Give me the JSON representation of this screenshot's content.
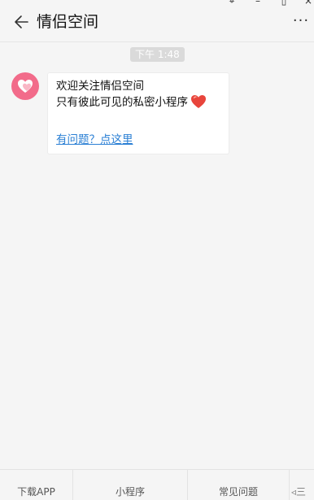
{
  "titlebar": {
    "title": "情侣空间",
    "pin_glyph": "⌖",
    "minimize_glyph": "–",
    "maximize_glyph": "▯",
    "close_glyph": "×",
    "more_glyph": "···"
  },
  "chat": {
    "timestamp": "下午 1:48",
    "message": {
      "line1": "欢迎关注情侣空间",
      "line2": "只有彼此可见的私密小程序",
      "link_text": "有问题？点这里"
    }
  },
  "bottom_menu": {
    "items": [
      "下载APP",
      "小程序",
      "常见问题"
    ],
    "keyboard_label": "◃三"
  },
  "colors": {
    "avatar_bg": "#f26b8a",
    "link": "#2a7fd4",
    "heart_emoji": "#e8453c"
  },
  "icons": [
    "back-arrow-icon",
    "pin-icon",
    "minimize-icon",
    "maximize-icon",
    "close-icon",
    "more-icon",
    "heart-emoji-icon",
    "keyboard-icon"
  ]
}
